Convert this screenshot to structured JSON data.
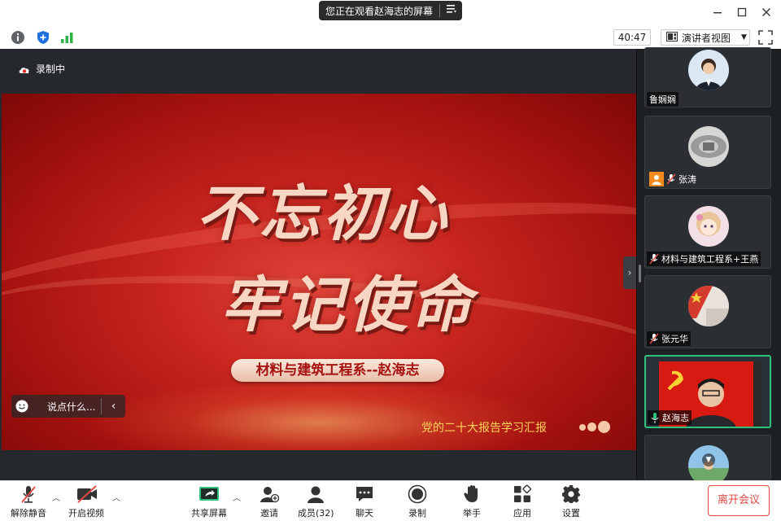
{
  "titlebar": {
    "share_status": "您正在观看赵海志的屏幕",
    "share_menu_icon": "list-menu-icon",
    "controls": [
      "minimize-icon",
      "maximize-icon",
      "close-icon"
    ]
  },
  "inforow": {
    "icons": [
      "info-icon",
      "shield-icon",
      "signal-icon"
    ],
    "timer": "40:47",
    "view_label": "演讲者视图",
    "fullscreen_icon": "fullscreen-icon"
  },
  "stage": {
    "recording_label": "录制中",
    "slide": {
      "line1": "不忘初心",
      "line2": "牢记使命",
      "presenter": "材料与建筑工程系--赵海志",
      "subtitle": "党的二十大报告学习汇报"
    },
    "chat_placeholder": "说点什么..."
  },
  "participants": [
    {
      "name": "鲁娴娴",
      "muted": false,
      "avatar_color": "#5b8fc8"
    },
    {
      "name": "张涛",
      "muted": true,
      "avatar_color": "#9a9a98"
    },
    {
      "name": "材料与建筑工程系+王燕",
      "muted": true,
      "avatar_color": "#e9c9b8"
    },
    {
      "name": "张元华",
      "muted": true,
      "avatar_color": "#d43b2e"
    },
    {
      "name": "赵海志",
      "muted": false,
      "speaking": true,
      "avatar_color": "#d91a12"
    },
    {
      "name": "",
      "muted": false,
      "avatar_color": "#6fa96a"
    }
  ],
  "toolbar": {
    "unmute": "解除静音",
    "start_video": "开启视频",
    "share_screen": "共享屏幕",
    "invite": "邀请",
    "members": "成员(32)",
    "chat": "聊天",
    "record": "录制",
    "raise_hand": "举手",
    "apps": "应用",
    "settings": "设置",
    "leave": "离开会议"
  },
  "colors": {
    "accent_green": "#2ec27e",
    "leave_red": "#e24a43",
    "stage_bg": "#25292d"
  }
}
